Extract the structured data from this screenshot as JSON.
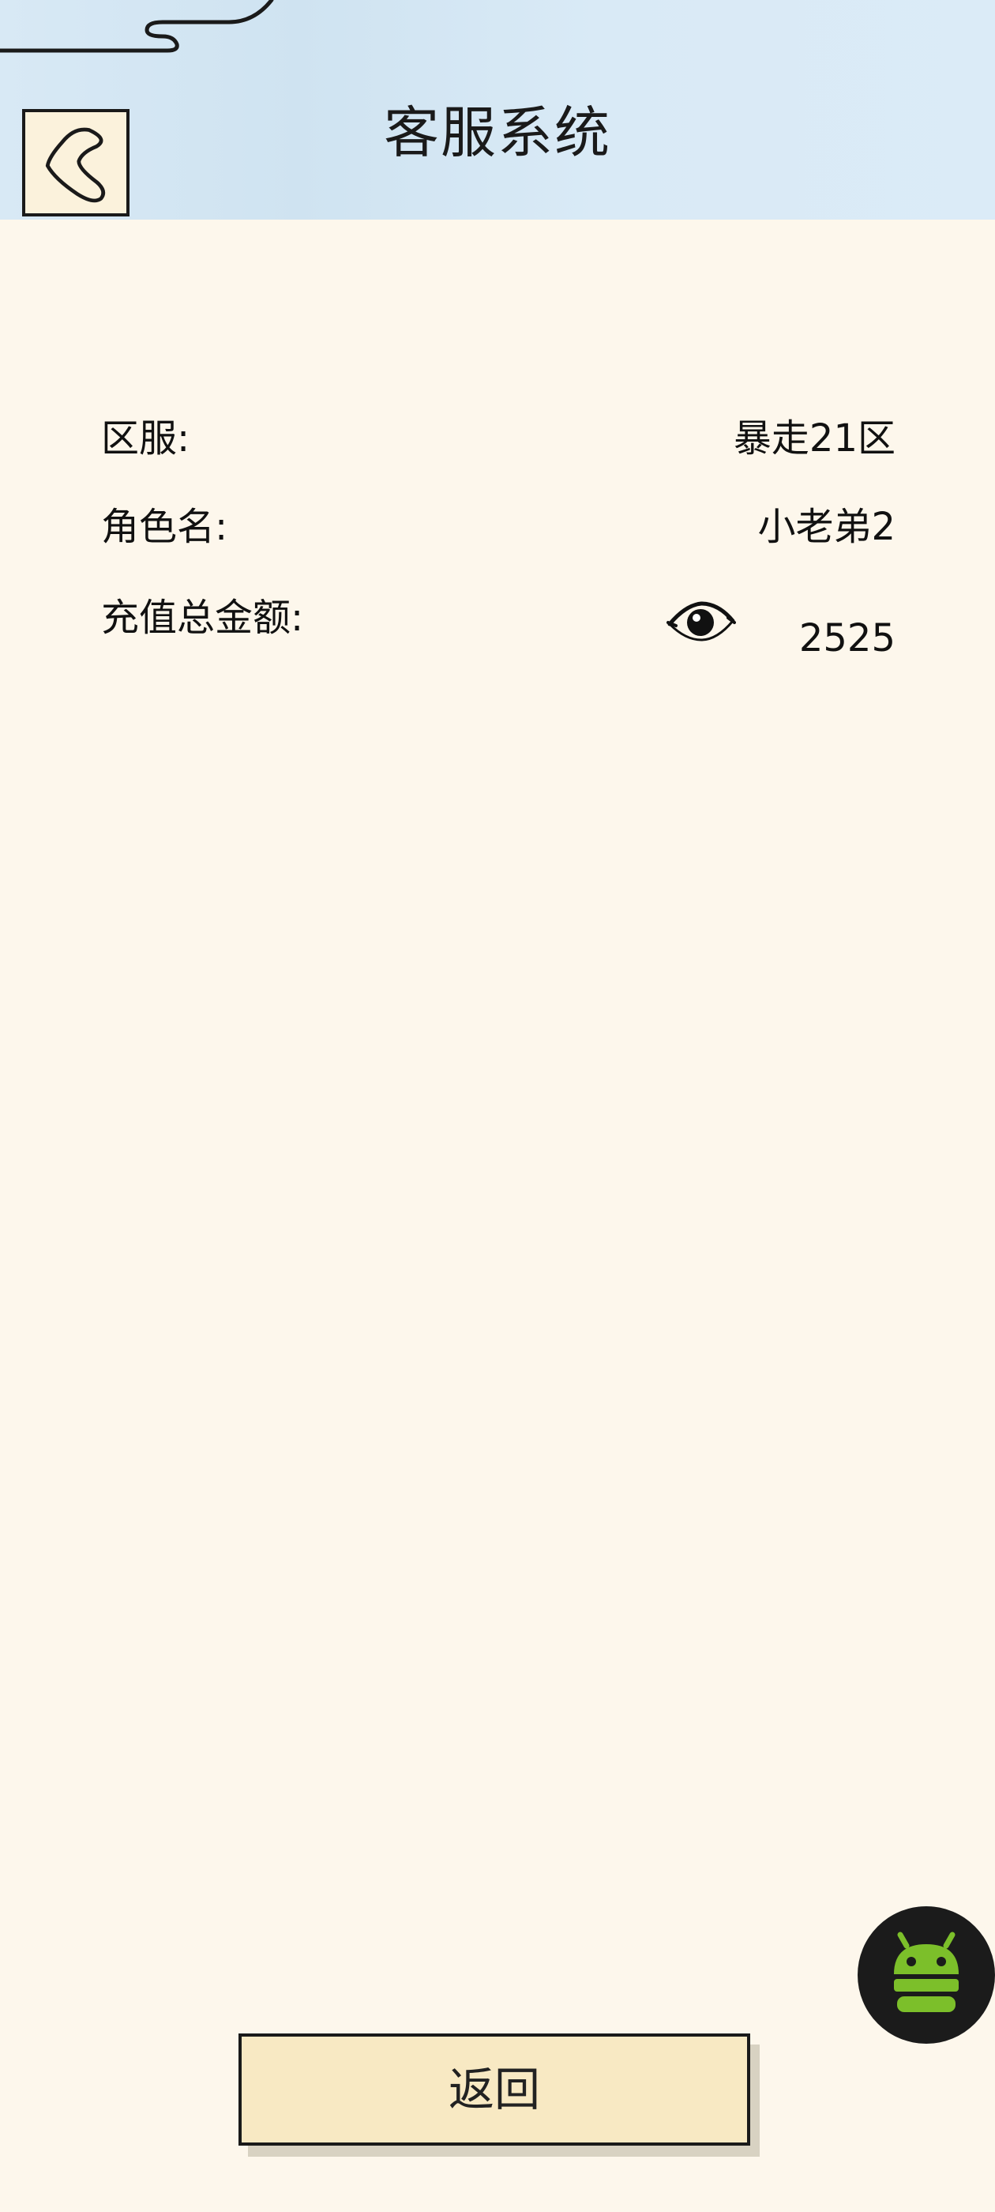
{
  "header": {
    "title": "客服系统",
    "back_icon": "back-chevron-icon"
  },
  "info": {
    "server_label": "区服:",
    "server_value": "暴走21区",
    "role_label": "角色名:",
    "role_value": "小老弟2",
    "recharge_label": "充值总金额:",
    "recharge_value": "2525",
    "visibility_icon": "eye-icon"
  },
  "footer": {
    "return_label": "返回"
  },
  "float_button": {
    "icon": "android-robot-icon"
  },
  "colors": {
    "background": "#fdf7ec",
    "header_background": "#d8e9f5",
    "button_fill": "#f8e9c3",
    "android_green": "#7cbf2a",
    "float_bg": "#1b1b1b"
  }
}
